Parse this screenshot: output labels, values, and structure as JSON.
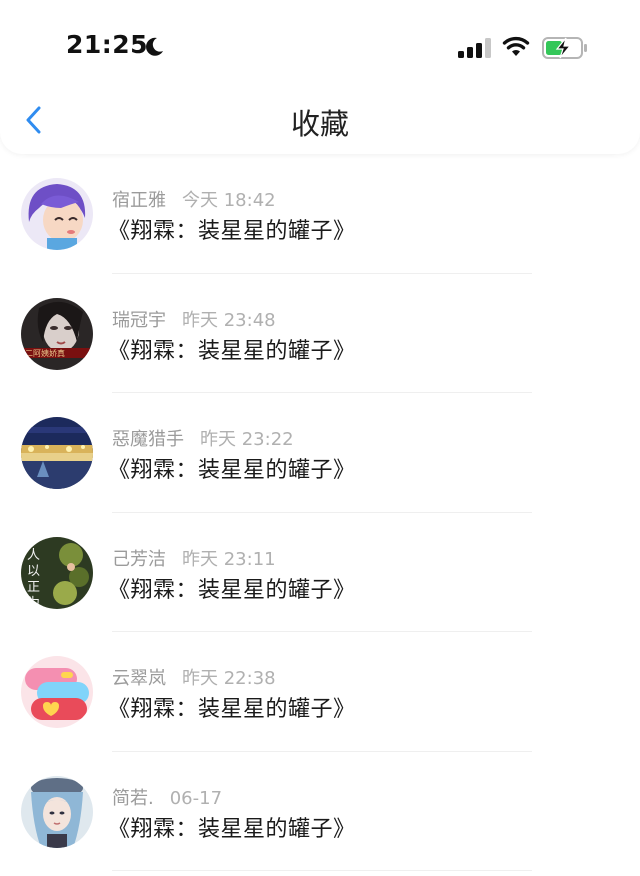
{
  "status_bar": {
    "time": "21:25"
  },
  "header": {
    "title": "收藏"
  },
  "items": [
    {
      "name": "宿正雅",
      "time": "今天 18:42",
      "title": "《翔霖：装星星的罐子》"
    },
    {
      "name": "瑞冠宇",
      "time": "昨天 23:48",
      "title": "《翔霖：装星星的罐子》"
    },
    {
      "name": "惡魔猎手",
      "time": "昨天 23:22",
      "title": "《翔霖：装星星的罐子》"
    },
    {
      "name": "己芳洁",
      "time": "昨天 23:11",
      "title": "《翔霖：装星星的罐子》"
    },
    {
      "name": "云翠岚",
      "time": "昨天 22:38",
      "title": "《翔霖：装星星的罐子》"
    },
    {
      "name": "简若.",
      "time": "06-17",
      "title": "《翔霖：装星星的罐子》"
    }
  ],
  "colors": {
    "accent": "#2f8cf0",
    "battery_fill": "#34c759"
  }
}
